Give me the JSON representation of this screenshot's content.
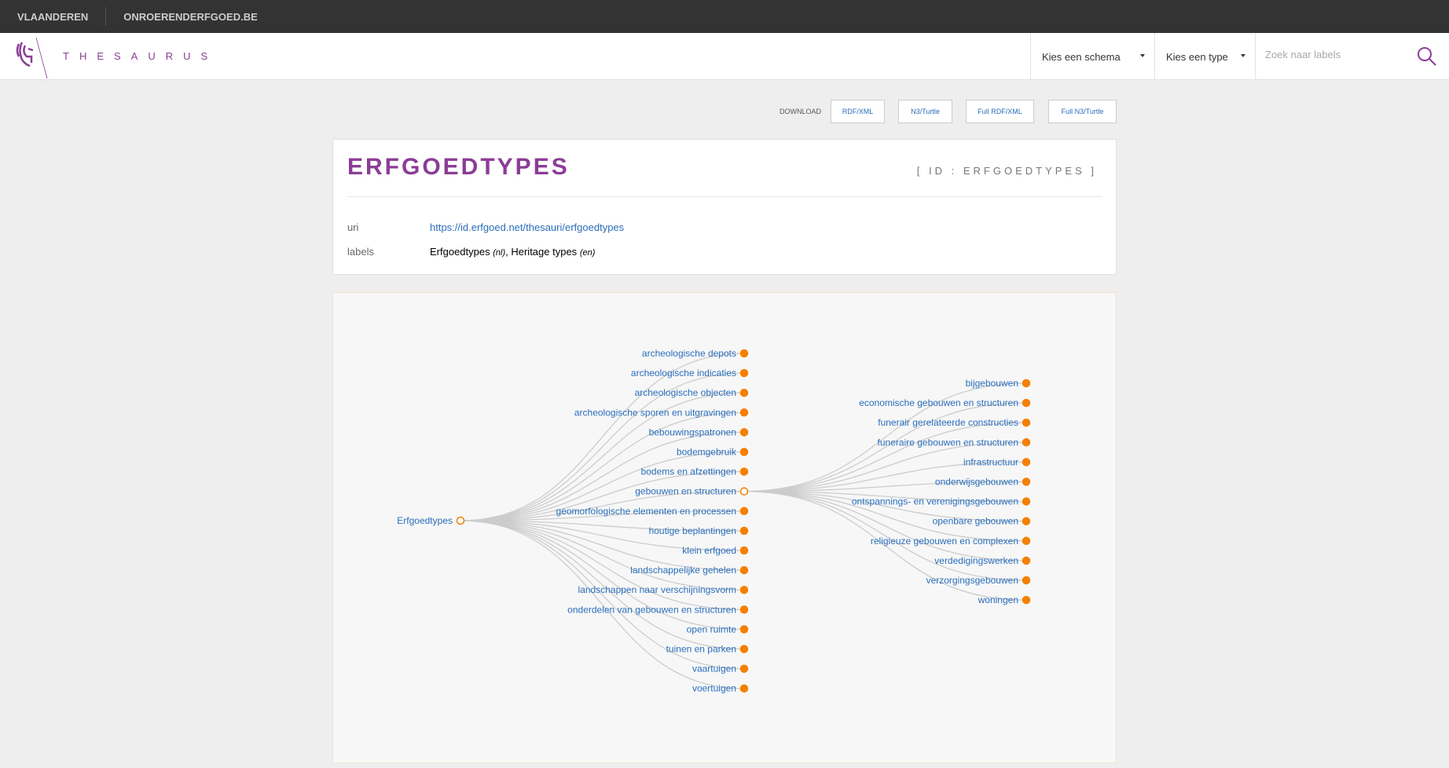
{
  "topbar": {
    "links": [
      "VLAANDEREN",
      "ONROERENDERFGOED.BE"
    ]
  },
  "header": {
    "brand": "THESAURUS",
    "schema_select": "Kies een schema",
    "type_select": "Kies een type",
    "search_placeholder": "Zoek naar labels"
  },
  "download": {
    "label": "DOWNLOAD",
    "buttons": [
      "RDF/XML",
      "N3/Turtle",
      "Full RDF/XML",
      "Full N3/Turtle"
    ]
  },
  "concept": {
    "title": "ERFGOEDTYPES",
    "id_tag": "[ ID : ERFGOEDTYPES ]",
    "uri_label": "uri",
    "uri": "https://id.erfgoed.net/thesauri/erfgoedtypes",
    "labels_label": "labels",
    "label_nl": "Erfgoedtypes",
    "lang_nl": "(nl)",
    "label_en": "Heritage types",
    "lang_en": "(en)"
  },
  "tree": {
    "root": "Erfgoedtypes",
    "children": [
      "archeologische depots",
      "archeologische indicaties",
      "archeologische objecten",
      "archeologische sporen en uitgravingen",
      "bebouwingspatronen",
      "bodemgebruik",
      "bodems en afzettingen",
      "gebouwen en structuren",
      "geomorfologische elementen en processen",
      "houtige beplantingen",
      "klein erfgoed",
      "landschappelijke gehelen",
      "landschappen naar verschijningsvorm",
      "onderdelen van gebouwen en structuren",
      "open ruimte",
      "tuinen en parken",
      "vaartuigen",
      "voertuigen"
    ],
    "expanded_index": 7,
    "grandchildren": [
      "bijgebouwen",
      "economische gebouwen en structuren",
      "funerair gerelateerde constructies",
      "funeraire gebouwen en structuren",
      "infrastructuur",
      "onderwijsgebouwen",
      "ontspannings- en verenigingsgebouwen",
      "openbare gebouwen",
      "religieuze gebouwen en complexen",
      "verdedigingswerken",
      "verzorgingsgebouwen",
      "woningen"
    ],
    "colors": {
      "node": "#f57f00",
      "link": "#cccccc",
      "text": "#2a6ebb"
    }
  }
}
